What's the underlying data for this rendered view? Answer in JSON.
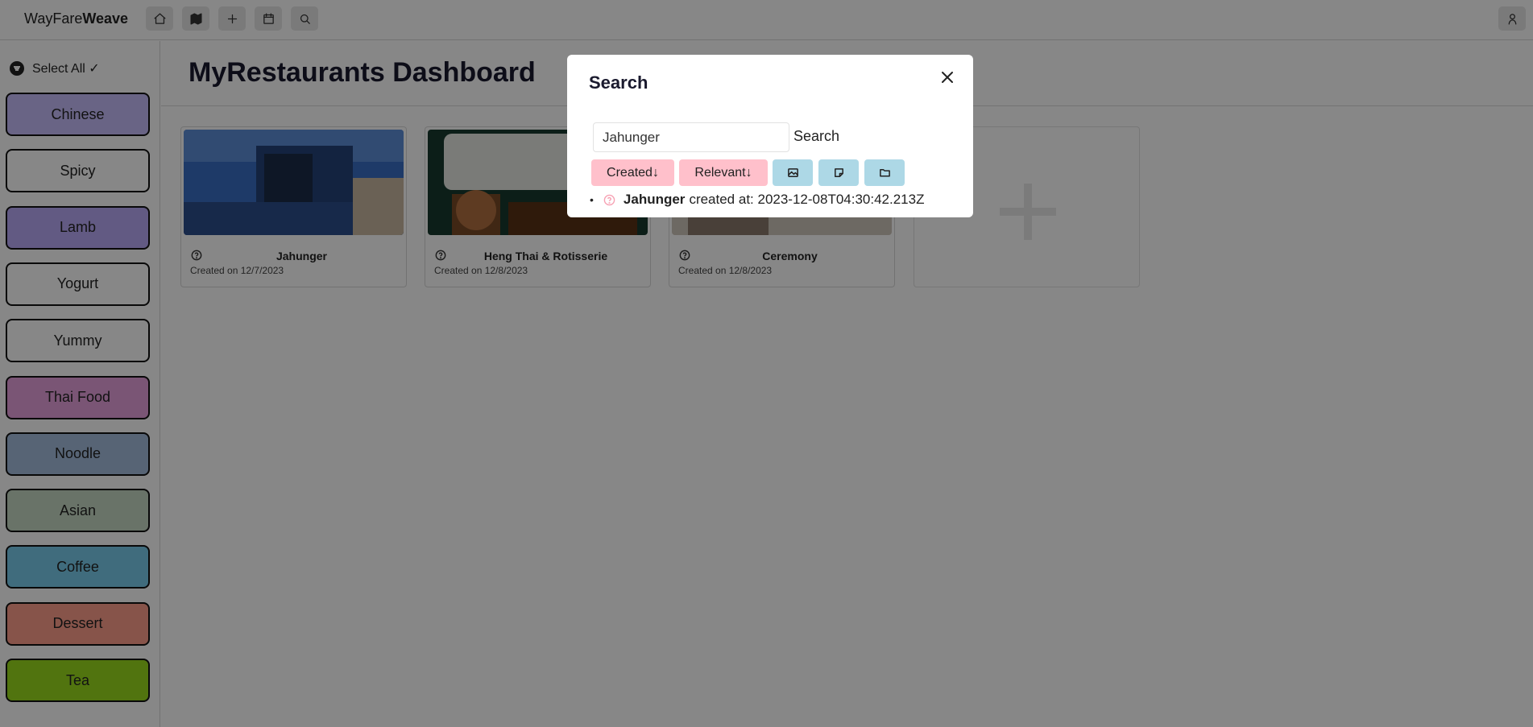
{
  "brand": {
    "regular": "WayFare",
    "bold": "Weave"
  },
  "topbar": {
    "icons": [
      "home-icon",
      "map-icon",
      "plus-icon",
      "calendar-icon",
      "search-icon"
    ],
    "user_icon": "user-icon"
  },
  "sidebar": {
    "select_all": "Select All ✓",
    "categories": [
      {
        "label": "Chinese",
        "color": "#c7bdfb"
      },
      {
        "label": "Spicy",
        "color": "#ffffff"
      },
      {
        "label": "Lamb",
        "color": "#b9aaf7"
      },
      {
        "label": "Yogurt",
        "color": "#ffffff"
      },
      {
        "label": "Yummy",
        "color": "#ffffff"
      },
      {
        "label": "Thai Food",
        "color": "#e7a1de"
      },
      {
        "label": "Noodle",
        "color": "#a5bdde"
      },
      {
        "label": "Asian",
        "color": "#c6dac4"
      },
      {
        "label": "Coffee",
        "color": "#7acdec"
      },
      {
        "label": "Dessert",
        "color": "#ff9f8c"
      },
      {
        "label": "Tea",
        "color": "#99db1e"
      }
    ]
  },
  "main": {
    "title": "MyRestaurants Dashboard",
    "cards": [
      {
        "name": "Jahunger",
        "created": "Created on 12/7/2023"
      },
      {
        "name": "Heng Thai & Rotisserie",
        "created": "Created on 12/8/2023"
      },
      {
        "name": "Ceremony",
        "created": "Created on 12/8/2023"
      }
    ]
  },
  "modal": {
    "title": "Search",
    "query": "Jahunger",
    "search_label": "Search",
    "sort_created": "Created↓",
    "sort_relevant": "Relevant↓",
    "filter_icons": [
      "image-icon",
      "note-icon",
      "folder-icon"
    ],
    "result": {
      "name": "Jahunger",
      "text": "created at: 2023-12-08T04:30:42.213Z"
    }
  },
  "colors": {
    "pink_button": "#ffc0cb",
    "blue_button": "#add8e6"
  }
}
